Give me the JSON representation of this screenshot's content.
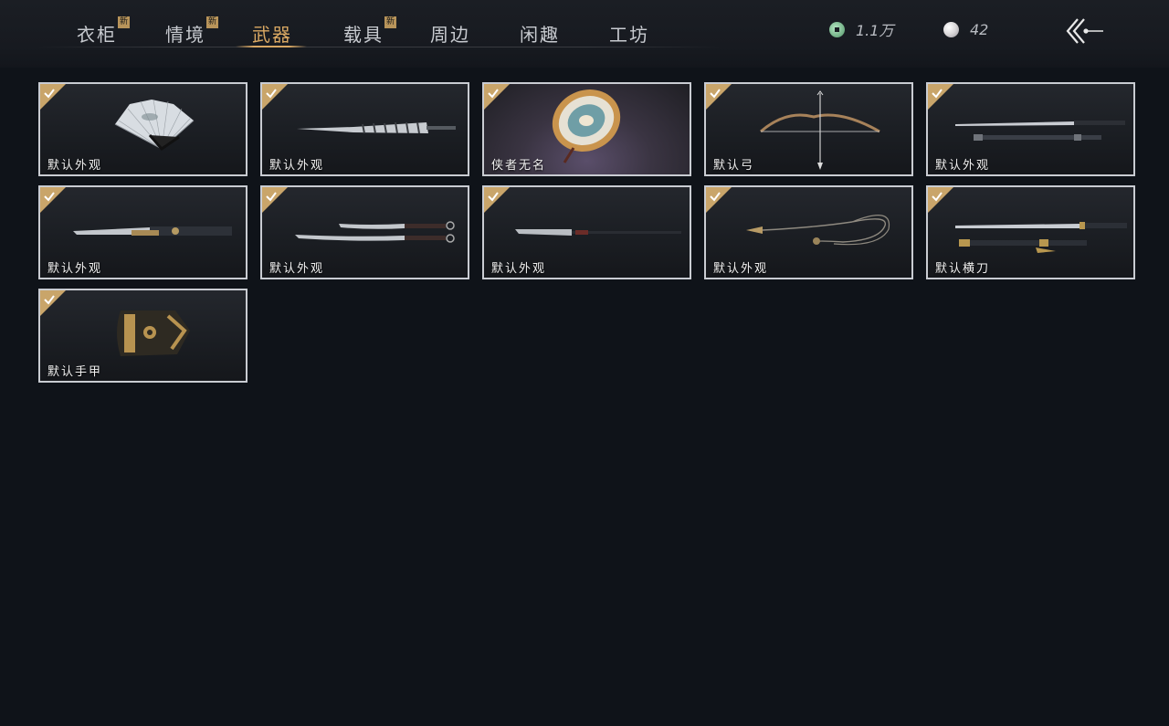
{
  "tabs": [
    {
      "label": "衣柜",
      "new": true,
      "new_badge": "新"
    },
    {
      "label": "情境",
      "new": true,
      "new_badge": "新"
    },
    {
      "label": "武器",
      "active": true
    },
    {
      "label": "载具",
      "new": true,
      "new_badge": "新"
    },
    {
      "label": "周边"
    },
    {
      "label": "闲趣"
    },
    {
      "label": "工坊"
    }
  ],
  "currencies": [
    {
      "icon": "jade-coin-icon",
      "value": "1.1万"
    },
    {
      "icon": "pearl-icon",
      "value": "42"
    }
  ],
  "colors": {
    "accent": "#d9a863",
    "background": "#0f1319",
    "card_border": "#c9ccd2",
    "check_badge": "#c9a56a"
  },
  "items": [
    {
      "label": "默认外观",
      "icon": "fan-icon",
      "equipped": true
    },
    {
      "label": "默认外观",
      "icon": "umbrella-icon",
      "equipped": true
    },
    {
      "label": "侠者无名",
      "icon": "parasol-icon",
      "equipped": true
    },
    {
      "label": "默认弓",
      "icon": "bow-icon",
      "equipped": true
    },
    {
      "label": "默认外观",
      "icon": "twin-swords-icon",
      "equipped": true
    },
    {
      "label": "默认外观",
      "icon": "sheathed-blade-icon",
      "equipped": true
    },
    {
      "label": "默认外观",
      "icon": "dual-dao-icon",
      "equipped": true
    },
    {
      "label": "默认外观",
      "icon": "glaive-icon",
      "equipped": true
    },
    {
      "label": "默认外观",
      "icon": "rope-dart-icon",
      "equipped": true
    },
    {
      "label": "默认横刀",
      "icon": "hengdao-icon",
      "equipped": true
    },
    {
      "label": "默认手甲",
      "icon": "gauntlet-icon",
      "equipped": true
    }
  ]
}
